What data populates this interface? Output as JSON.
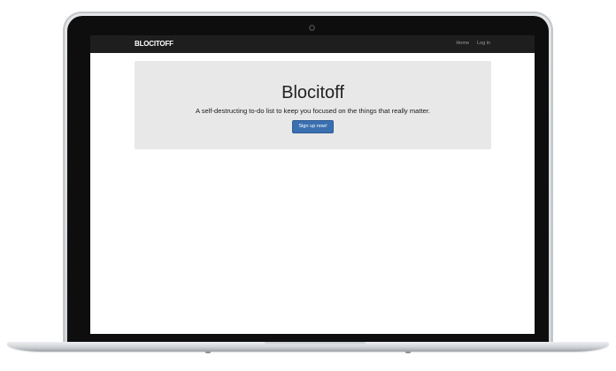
{
  "navbar": {
    "brand": "BLOCITOFF",
    "links": [
      {
        "label": "Home"
      },
      {
        "label": "Log in"
      }
    ]
  },
  "jumbotron": {
    "title": "Blocitoff",
    "subtitle": "A self-destructing to-do list to keep you focused on the things that really matter.",
    "cta_label": "Sign up now!"
  },
  "colors": {
    "navbar_bg": "#1e1e1e",
    "jumbotron_bg": "#e8e8e8",
    "cta_bg": "#3a6fb0"
  }
}
